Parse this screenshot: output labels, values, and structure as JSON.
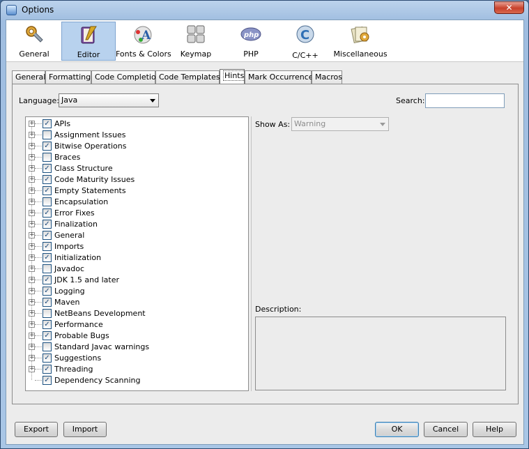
{
  "window": {
    "title": "Options",
    "close_glyph": "✕"
  },
  "categories": [
    {
      "label": "General",
      "icon": "gear-wrench-icon"
    },
    {
      "label": "Editor",
      "icon": "notebook-pen-icon",
      "selected": true
    },
    {
      "label": "Fonts & Colors",
      "icon": "fonts-palette-icon"
    },
    {
      "label": "Keymap",
      "icon": "keyboard-icon"
    },
    {
      "label": "PHP",
      "icon": "php-icon"
    },
    {
      "label": "C/C++",
      "icon": "c-cpp-icon"
    },
    {
      "label": "Miscellaneous",
      "icon": "misc-gear-icon"
    }
  ],
  "tabs": [
    {
      "label": "General"
    },
    {
      "label": "Formatting"
    },
    {
      "label": "Code Completion"
    },
    {
      "label": "Code Templates"
    },
    {
      "label": "Hints",
      "active": true
    },
    {
      "label": "Mark Occurrences"
    },
    {
      "label": "Macros"
    }
  ],
  "hints": {
    "language_label": "Language:",
    "language_value": "Java",
    "search_label": "Search:",
    "search_value": "",
    "show_as_label": "Show As:",
    "show_as_value": "Warning",
    "description_label": "Description:",
    "tree": [
      {
        "label": "APIs",
        "checked": true,
        "expandable": true
      },
      {
        "label": "Assignment Issues",
        "checked": false,
        "expandable": true
      },
      {
        "label": "Bitwise Operations",
        "checked": true,
        "expandable": true
      },
      {
        "label": "Braces",
        "checked": false,
        "expandable": true
      },
      {
        "label": "Class Structure",
        "checked": true,
        "expandable": true
      },
      {
        "label": "Code Maturity Issues",
        "checked": true,
        "expandable": true
      },
      {
        "label": "Empty Statements",
        "checked": true,
        "expandable": true
      },
      {
        "label": "Encapsulation",
        "checked": false,
        "expandable": true
      },
      {
        "label": "Error Fixes",
        "checked": true,
        "expandable": true
      },
      {
        "label": "Finalization",
        "checked": true,
        "expandable": true
      },
      {
        "label": "General",
        "checked": true,
        "expandable": true
      },
      {
        "label": "Imports",
        "checked": true,
        "expandable": true
      },
      {
        "label": "Initialization",
        "checked": true,
        "expandable": true
      },
      {
        "label": "Javadoc",
        "checked": false,
        "expandable": true
      },
      {
        "label": "JDK 1.5 and later",
        "checked": true,
        "expandable": true
      },
      {
        "label": "Logging",
        "checked": true,
        "expandable": true
      },
      {
        "label": "Maven",
        "checked": true,
        "expandable": true
      },
      {
        "label": "NetBeans Development",
        "checked": false,
        "expandable": true
      },
      {
        "label": "Performance",
        "checked": true,
        "expandable": true
      },
      {
        "label": "Probable Bugs",
        "checked": true,
        "expandable": true
      },
      {
        "label": "Standard Javac warnings",
        "checked": false,
        "expandable": true
      },
      {
        "label": "Suggestions",
        "checked": true,
        "expandable": true
      },
      {
        "label": "Threading",
        "checked": true,
        "expandable": true
      },
      {
        "label": "Dependency Scanning",
        "checked": true,
        "expandable": false
      }
    ]
  },
  "buttons": {
    "export": "Export",
    "import": "Import",
    "ok": "OK",
    "cancel": "Cancel",
    "help": "Help"
  }
}
